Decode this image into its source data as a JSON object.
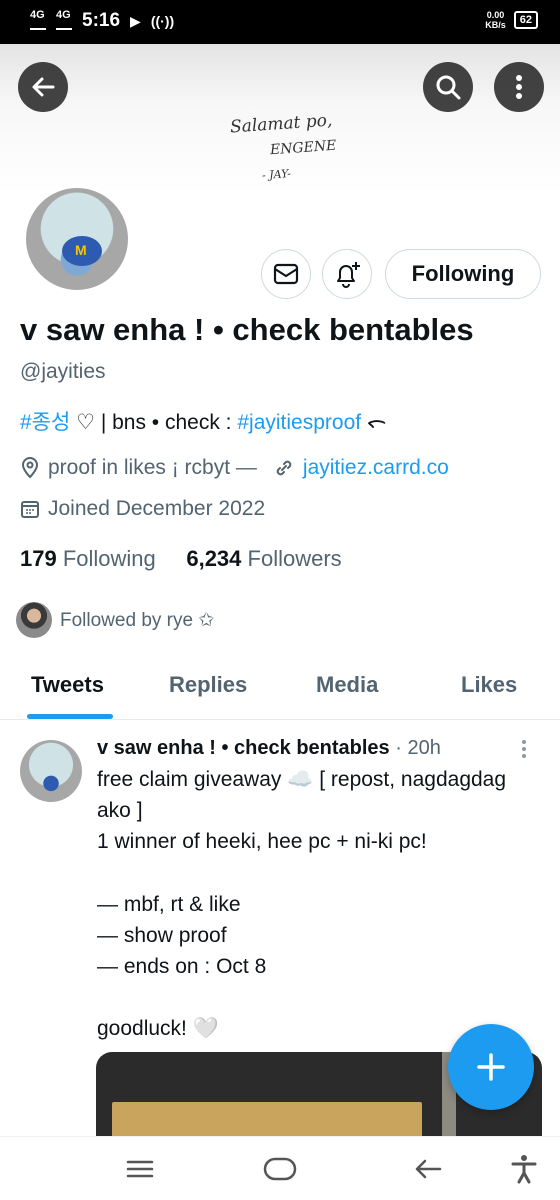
{
  "status_bar": {
    "net1": "4G",
    "net2": "4G",
    "time": "5:16",
    "speed_value": "0.00",
    "speed_unit": "KB/s",
    "battery": "62"
  },
  "banner": {
    "line1": "Salamat po,",
    "line2": "ENGENE",
    "line3": "- JAY-"
  },
  "profile": {
    "following_button": "Following",
    "name": "v saw enha ! • check bentables",
    "handle": "@jayities",
    "bio": {
      "hashtag1": "#종성",
      "middle": " ♡ | bns • check : ",
      "hashtag2": "#jayitiesproof",
      "end": " ᯞ"
    },
    "location": "proof in likes ¡ rcbyt —",
    "website": "jayitiez.carrd.co",
    "joined": "Joined December 2022",
    "following_count": "179",
    "following_label": "Following",
    "followers_count": "6,234",
    "followers_label": "Followers",
    "followed_by": "Followed by rye ✩"
  },
  "tabs": [
    "Tweets",
    "Replies",
    "Media",
    "Likes"
  ],
  "tweet": {
    "author": "v saw enha ! • check bentables",
    "time": "· 20h",
    "lines": [
      "free claim giveaway ☁️ [ repost, nagdagdag",
      "ako ]",
      "1 winner of heeki, hee pc + ni-ki pc!",
      "— mbf, rt & like",
      "— show proof",
      "— ends on : Oct 8",
      "goodluck! 🤍"
    ]
  },
  "colors": {
    "accent": "#1d9bf0",
    "text": "#0f1419",
    "secondary": "#536471"
  }
}
